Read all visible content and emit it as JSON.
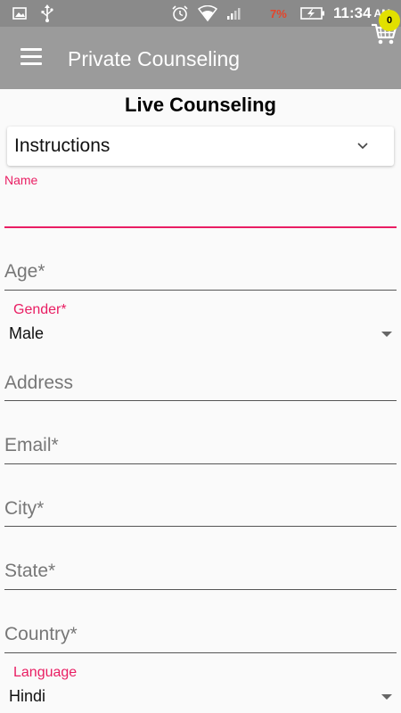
{
  "status_bar": {
    "battery_percent": "7%",
    "time": "11:34",
    "ampm": "AM"
  },
  "app_bar": {
    "title": "Private Counseling",
    "cart_count": "0"
  },
  "form": {
    "heading": "Live Counseling",
    "instructions_label": "Instructions",
    "name_label": "Name",
    "age_placeholder": "Age*",
    "gender_label": "Gender*",
    "gender_value": "Male",
    "address_placeholder": "Address",
    "email_placeholder": "Email*",
    "city_placeholder": "City*",
    "state_placeholder": "State*",
    "country_placeholder": "Country*",
    "language_label": "Language",
    "language_value": "Hindi"
  },
  "colors": {
    "accent": "#e91e63",
    "app_bar": "#9b9b9b",
    "status_bar": "#8a8a8a",
    "badge": "#e2e000"
  }
}
